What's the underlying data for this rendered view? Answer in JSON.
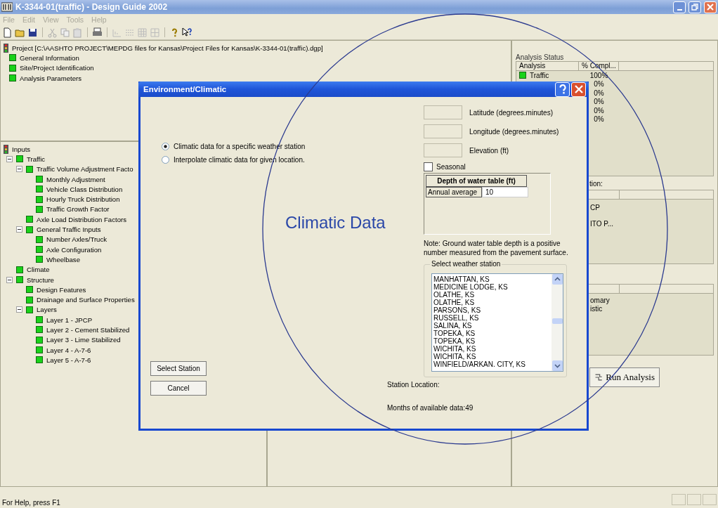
{
  "window": {
    "title": "K-3344-01(traffic) - Design Guide 2002"
  },
  "menu": [
    "File",
    "Edit",
    "View",
    "Tools",
    "Help"
  ],
  "project_tree": {
    "label": "Project [C:\\AASHTO PROJECT\\MEPDG files for Kansas\\Project Files for Kansas\\K-3344-01(traffic).dgp]",
    "children": [
      {
        "label": "General Information"
      },
      {
        "label": "Site/Project Identification"
      },
      {
        "label": "Analysis Parameters"
      }
    ]
  },
  "inputs_tree": {
    "label": "Inputs",
    "children": [
      {
        "label": "Traffic",
        "expanded": true,
        "children": [
          {
            "label": "Traffic Volume Adjustment Facto",
            "expanded": true,
            "children": [
              {
                "label": "Monthly Adjustment"
              },
              {
                "label": "Vehicle Class Distribution"
              },
              {
                "label": "Hourly Truck Distribution"
              },
              {
                "label": "Traffic Growth Factor"
              }
            ]
          },
          {
            "label": "Axle Load Distribution Factors"
          },
          {
            "label": "General Traffic Inputs",
            "expanded": true,
            "children": [
              {
                "label": "Number Axles/Truck"
              },
              {
                "label": "Axle Configuration"
              },
              {
                "label": "Wheelbase"
              }
            ]
          }
        ]
      },
      {
        "label": "Climate"
      },
      {
        "label": "Structure",
        "expanded": true,
        "children": [
          {
            "label": "Design Features"
          },
          {
            "label": "Drainage and Surface Properties"
          },
          {
            "label": "Layers",
            "expanded": true,
            "children": [
              {
                "label": "Layer 1 - JPCP"
              },
              {
                "label": "Layer 2 - Cement Stabilized"
              },
              {
                "label": "Layer 3 - Lime Stabilized"
              },
              {
                "label": "Layer 4 - A-7-6"
              },
              {
                "label": "Layer 5 - A-7-6"
              }
            ]
          }
        ]
      }
    ]
  },
  "analysis_status": {
    "label": "Analysis Status",
    "columns": [
      "Analysis",
      "% Compl..."
    ],
    "rows": [
      {
        "name": "Traffic",
        "percent": "100%"
      },
      {
        "percent": "0%"
      },
      {
        "percent": "0%"
      },
      {
        "percent": "0%"
      },
      {
        "percent": "0%"
      },
      {
        "percent": "0%"
      }
    ]
  },
  "second_panel": {
    "label": "tion:",
    "rows": [
      "CP",
      "ITO P..."
    ]
  },
  "third_panel": {
    "rows": [
      "omary",
      "istic"
    ]
  },
  "run_button": "Run Analysis",
  "dialog": {
    "title": "Environment/Climatic",
    "radios": [
      {
        "label": "Climatic data for a specific weather station",
        "selected": true
      },
      {
        "label": "Interpolate climatic data for given location.",
        "selected": false
      }
    ],
    "fields": [
      {
        "label": "Latitude (degrees.minutes)"
      },
      {
        "label": "Longitude (degrees.minutes)"
      },
      {
        "label": "Elevation (ft)"
      }
    ],
    "seasonal": {
      "label": "Seasonal",
      "checked": false
    },
    "water_table": {
      "header": "Depth of water table (ft)",
      "row_label": "Annual average",
      "value": "10"
    },
    "note": "Note: Ground water table depth is a positive number measured from the pavement surface.",
    "station_group": {
      "label": "Select weather station",
      "stations": [
        "MANHATTAN, KS",
        "MEDICINE LODGE, KS",
        "OLATHE, KS",
        "OLATHE, KS",
        "PARSONS, KS",
        "RUSSELL, KS",
        "SALINA, KS",
        "TOPEKA, KS",
        "TOPEKA, KS",
        "WICHITA, KS",
        "WICHITA, KS",
        "WINFIELD/ARKAN. CITY, KS"
      ]
    },
    "annotation": "Climatic Data",
    "buttons": [
      "Select Station",
      "Cancel"
    ],
    "station_location": "Station Location:",
    "months": "Months of available data:49"
  },
  "status_bar": "For Help, press F1"
}
